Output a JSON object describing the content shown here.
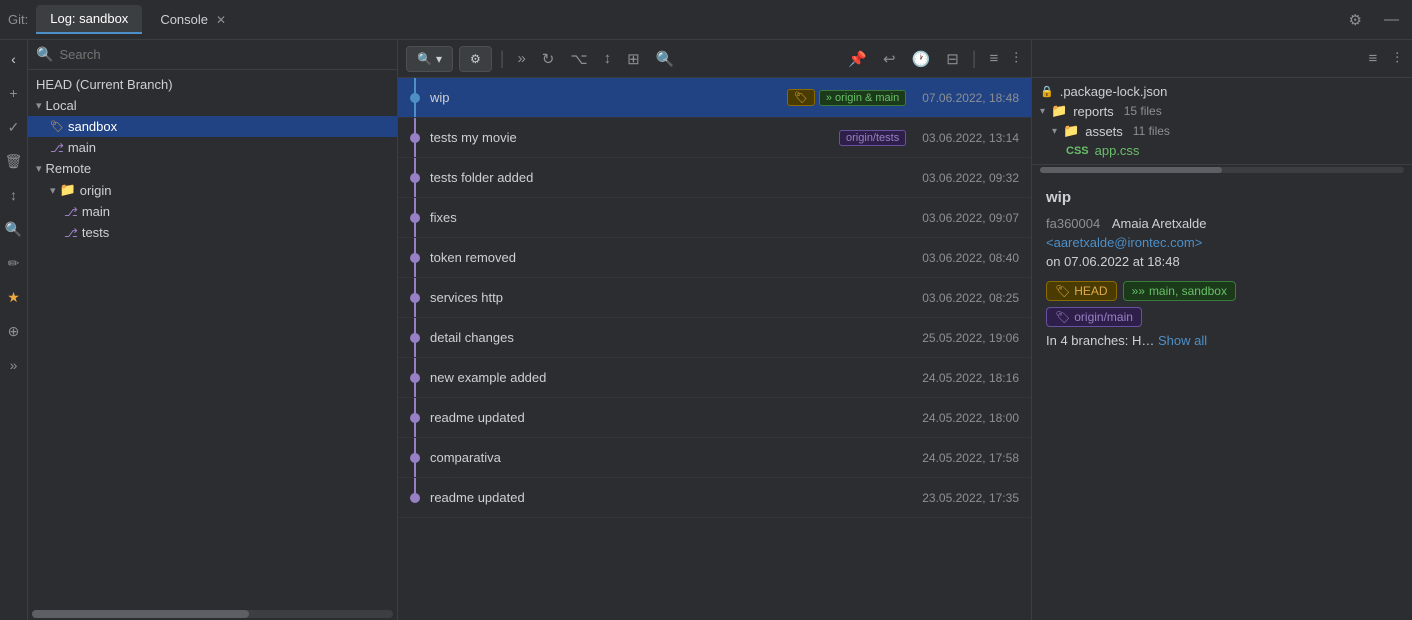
{
  "app": {
    "git_label": "Git:",
    "tabs": [
      {
        "id": "log",
        "label": "Log: sandbox",
        "active": true,
        "closeable": false
      },
      {
        "id": "console",
        "label": "Console",
        "active": false,
        "closeable": true
      }
    ]
  },
  "toolbar_icons": {
    "settings": "⚙",
    "minimize": "—"
  },
  "sidebar": {
    "search_placeholder": "Search",
    "head_label": "HEAD (Current Branch)",
    "local_label": "Local",
    "sandbox_branch": "sandbox",
    "main_branch": "main",
    "remote_label": "Remote",
    "origin_label": "origin",
    "origin_main": "main",
    "origin_tests": "tests"
  },
  "commit_toolbar": {
    "search_placeholder": "Search",
    "icons": [
      "≫",
      "↻",
      "⌥",
      "↕",
      "⊞",
      "🔍"
    ]
  },
  "commits": [
    {
      "id": 1,
      "message": "wip",
      "tags": [
        "yellow-tag",
        "green-arrow"
      ],
      "tag_labels": [
        "",
        "origin & main"
      ],
      "date": "07.06.2022, 18:48",
      "selected": true,
      "first": true
    },
    {
      "id": 2,
      "message": "tests my movie",
      "tags": [
        "purple-tag"
      ],
      "tag_labels": [
        "origin/tests"
      ],
      "date": "03.06.2022, 13:14",
      "selected": false
    },
    {
      "id": 3,
      "message": "tests folder added",
      "tags": [],
      "tag_labels": [],
      "date": "03.06.2022, 09:32",
      "selected": false
    },
    {
      "id": 4,
      "message": "fixes",
      "tags": [],
      "tag_labels": [],
      "date": "03.06.2022, 09:07",
      "selected": false
    },
    {
      "id": 5,
      "message": "token removed",
      "tags": [],
      "tag_labels": [],
      "date": "03.06.2022, 08:40",
      "selected": false
    },
    {
      "id": 6,
      "message": "services http",
      "tags": [],
      "tag_labels": [],
      "date": "03.06.2022, 08:25",
      "selected": false
    },
    {
      "id": 7,
      "message": "detail changes",
      "tags": [],
      "tag_labels": [],
      "date": "25.05.2022, 19:06",
      "selected": false
    },
    {
      "id": 8,
      "message": "new example added",
      "tags": [],
      "tag_labels": [],
      "date": "24.05.2022, 18:16",
      "selected": false
    },
    {
      "id": 9,
      "message": "readme updated",
      "tags": [],
      "tag_labels": [],
      "date": "24.05.2022, 18:00",
      "selected": false
    },
    {
      "id": 10,
      "message": "comparativa",
      "tags": [],
      "tag_labels": [],
      "date": "24.05.2022, 17:58",
      "selected": false
    },
    {
      "id": 11,
      "message": "readme updated",
      "tags": [],
      "tag_labels": [],
      "date": "23.05.2022, 17:35",
      "selected": false
    }
  ],
  "file_tree": {
    "package_lock": ".package-lock.json",
    "reports": "reports",
    "reports_count": "15 files",
    "assets": "assets",
    "assets_count": "11 files",
    "app_css": "app.css"
  },
  "commit_detail": {
    "title": "wip",
    "hash": "fa360004",
    "author": "Amaia Aretxalde",
    "email": "<aaretxalde@irontec.com>",
    "date_label": "on 07.06.2022 at 18:48",
    "tags": [
      {
        "type": "yellow",
        "label": "HEAD"
      },
      {
        "type": "green",
        "label": "main, sandbox"
      },
      {
        "type": "purple",
        "label": "origin/main"
      }
    ],
    "in_branches_prefix": "In 4 branches: H…",
    "show_all_label": "Show all"
  },
  "vertical_icons": [
    "‹",
    "+",
    "✓",
    "🗑",
    "↕",
    "🔍",
    "✏",
    "★",
    "⊕",
    "≫"
  ]
}
